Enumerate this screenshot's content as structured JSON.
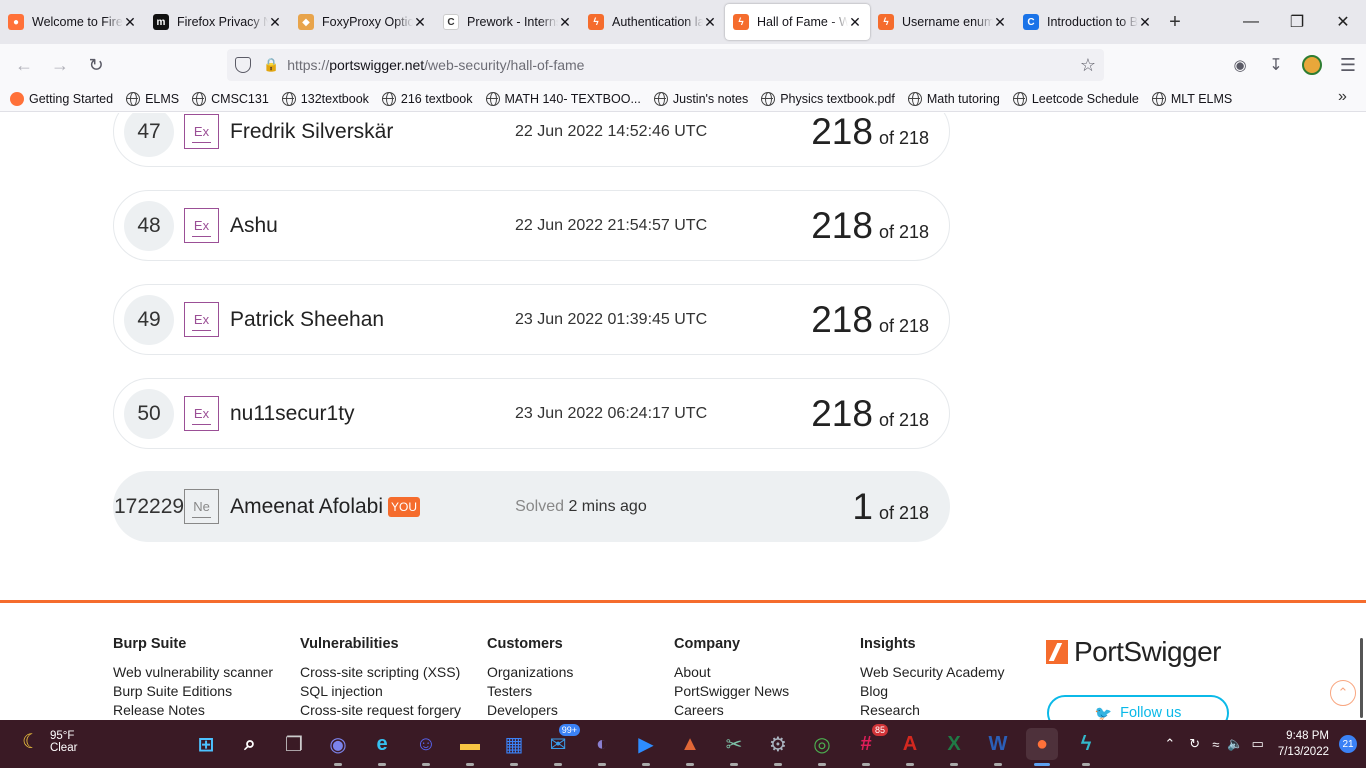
{
  "tabs": [
    {
      "title": "Welcome to Firefox",
      "icon": "firefox-icon",
      "color": "#ff7139",
      "glyph": "●"
    },
    {
      "title": "Firefox Privacy Notice",
      "icon": "mozilla-m-icon",
      "color": "#111111",
      "glyph": "m"
    },
    {
      "title": "FoxyProxy Options",
      "icon": "foxyproxy-icon",
      "color": "#e8a44b",
      "glyph": "◆"
    },
    {
      "title": "Prework - Internship",
      "icon": "codepath-icon",
      "color": "#ffffff",
      "glyph": "C"
    },
    {
      "title": "Authentication lab",
      "icon": "portswigger-icon",
      "color": "#f56c2d",
      "glyph": "ϟ"
    },
    {
      "title": "Hall of Fame - Web Security",
      "icon": "portswigger-icon",
      "color": "#f56c2d",
      "glyph": "ϟ",
      "active": true
    },
    {
      "title": "Username enumeration",
      "icon": "portswigger-icon",
      "color": "#f56c2d",
      "glyph": "ϟ"
    },
    {
      "title": "Introduction to Burp",
      "icon": "codepath-icon",
      "color": "#1a73e8",
      "glyph": "C"
    }
  ],
  "url": {
    "scheme": "https://",
    "host": "portswigger.net",
    "path": "/web-security/hall-of-fame"
  },
  "bookmarks": [
    "Getting Started",
    "ELMS",
    "CMSC131",
    "132textbook",
    "216 textbook",
    "MATH 140- TEXTBOO...",
    "Justin's notes",
    "Physics textbook.pdf",
    "Math tutoring",
    "Leetcode Schedule",
    "MLT ELMS"
  ],
  "leaderboard": [
    {
      "rank": "47",
      "level": "Ex",
      "name": "Fredrik Silverskär",
      "date": "22 Jun 2022 14:52:46 UTC",
      "score": "218",
      "of": "of 218"
    },
    {
      "rank": "48",
      "level": "Ex",
      "name": "Ashu",
      "date": "22 Jun 2022 21:54:57 UTC",
      "score": "218",
      "of": "of 218"
    },
    {
      "rank": "49",
      "level": "Ex",
      "name": "Patrick Sheehan",
      "date": "23 Jun 2022 01:39:45 UTC",
      "score": "218",
      "of": "of 218"
    },
    {
      "rank": "50",
      "level": "Ex",
      "name": "nu11secur1ty",
      "date": "23 Jun 2022 06:24:17 UTC",
      "score": "218",
      "of": "of 218"
    }
  ],
  "you": {
    "rank": "172229",
    "level": "Ne",
    "name": "Ameenat Afolabi",
    "badge": "YOU",
    "solved_label": "Solved",
    "solved_when": "2 mins ago",
    "score": "1",
    "of": "of 218"
  },
  "footer": {
    "columns": [
      {
        "title": "Burp Suite",
        "links": [
          "Web vulnerability scanner",
          "Burp Suite Editions",
          "Release Notes"
        ]
      },
      {
        "title": "Vulnerabilities",
        "links": [
          "Cross-site scripting (XSS)",
          "SQL injection",
          "Cross-site request forgery"
        ]
      },
      {
        "title": "Customers",
        "links": [
          "Organizations",
          "Testers",
          "Developers"
        ]
      },
      {
        "title": "Company",
        "links": [
          "About",
          "PortSwigger News",
          "Careers"
        ]
      },
      {
        "title": "Insights",
        "links": [
          "Web Security Academy",
          "Blog",
          "Research"
        ]
      }
    ],
    "brand": "PortSwigger",
    "follow": "Follow us"
  },
  "taskbar": {
    "weather_temp": "95°F",
    "weather_desc": "Clear",
    "time": "9:48 PM",
    "date": "7/13/2022",
    "notifications": "21",
    "apps": [
      {
        "name": "start-button",
        "glyph": "⊞",
        "color": "#4cc2ff"
      },
      {
        "name": "search-button",
        "glyph": "⌕",
        "color": "#ffffff"
      },
      {
        "name": "task-view-button",
        "glyph": "❐",
        "color": "#cccccc"
      },
      {
        "name": "teams-chat-app",
        "glyph": "◉",
        "color": "#7b83eb"
      },
      {
        "name": "edge-app",
        "glyph": "e",
        "color": "#35c1f1"
      },
      {
        "name": "discord-app",
        "glyph": "☺",
        "color": "#5865f2"
      },
      {
        "name": "file-explorer-app",
        "glyph": "▬",
        "color": "#f8c443"
      },
      {
        "name": "store-app",
        "glyph": "▦",
        "color": "#3b82f6"
      },
      {
        "name": "mail-app",
        "glyph": "✉",
        "color": "#3b9ce8",
        "badge": "99+"
      },
      {
        "name": "eclipse-app",
        "glyph": "◐",
        "color": "#8a7fd0"
      },
      {
        "name": "zoom-app",
        "glyph": "▶",
        "color": "#2d8cff"
      },
      {
        "name": "matlab-app",
        "glyph": "▲",
        "color": "#e16737"
      },
      {
        "name": "snipping-app",
        "glyph": "✂",
        "color": "#7cc0a6"
      },
      {
        "name": "settings-app",
        "glyph": "⚙",
        "color": "#aab4c0"
      },
      {
        "name": "chrome-app",
        "glyph": "◎",
        "color": "#4caf50"
      },
      {
        "name": "slack-app",
        "glyph": "#",
        "color": "#e01e5a",
        "badge": "85",
        "badge_red": true
      },
      {
        "name": "acrobat-app",
        "glyph": "A",
        "color": "#d4281f"
      },
      {
        "name": "excel-app",
        "glyph": "X",
        "color": "#1f7a45"
      },
      {
        "name": "word-app",
        "glyph": "W",
        "color": "#2b5fb8"
      },
      {
        "name": "firefox-app",
        "glyph": "●",
        "color": "#ff7139",
        "active": true
      },
      {
        "name": "burp-app",
        "glyph": "ϟ",
        "color": "#33b7c9"
      }
    ]
  }
}
